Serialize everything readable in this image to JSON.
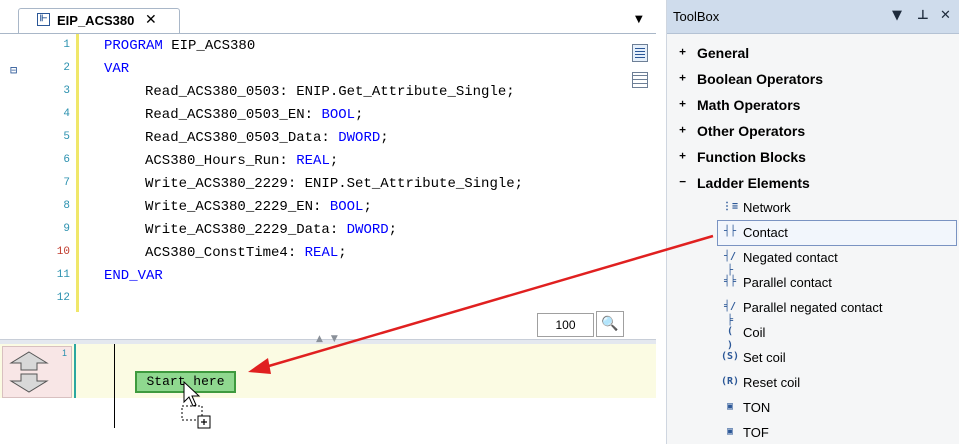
{
  "editor_tab": {
    "title": "EIP_ACS380",
    "close": "✕",
    "menu": "▼"
  },
  "code_lines": [
    {
      "num": "1",
      "text": "PROGRAM EIP_ACS380"
    },
    {
      "num": "2",
      "text": "VAR"
    },
    {
      "num": "3",
      "text": "Read_ACS380_0503: ENIP.Get_Attribute_Single;"
    },
    {
      "num": "4",
      "text": "Read_ACS380_0503_EN: BOOL;"
    },
    {
      "num": "5",
      "text": "Read_ACS380_0503_Data: DWORD;"
    },
    {
      "num": "6",
      "text": "ACS380_Hours_Run: REAL;"
    },
    {
      "num": "7",
      "text": "Write_ACS380_2229: ENIP.Set_Attribute_Single;"
    },
    {
      "num": "8",
      "text": "Write_ACS380_2229_EN: BOOL;"
    },
    {
      "num": "9",
      "text": "Write_ACS380_2229_Data: DWORD;"
    },
    {
      "num": "10",
      "text": "ACS380_ConstTime4: REAL;"
    },
    {
      "num": "11",
      "text": "END_VAR"
    },
    {
      "num": "12",
      "text": ""
    }
  ],
  "zoom": {
    "value": "100"
  },
  "ladder": {
    "network_number": "1",
    "start_here": "Start here"
  },
  "toolbox": {
    "title": "ToolBox",
    "controls": {
      "menu": "▼",
      "pin": "ᵖ",
      "close": "✕"
    },
    "categories": [
      {
        "label": "General",
        "expander": "+"
      },
      {
        "label": "Boolean Operators",
        "expander": "+"
      },
      {
        "label": "Math Operators",
        "expander": "+"
      },
      {
        "label": "Other Operators",
        "expander": "+"
      },
      {
        "label": "Function Blocks",
        "expander": "+"
      },
      {
        "label": "Ladder Elements",
        "expander": "−"
      }
    ],
    "ladder_items": [
      {
        "label": "Network",
        "icon": "network-icon",
        "glyph": "⋮≡"
      },
      {
        "label": "Contact",
        "icon": "contact-icon",
        "glyph": "┤├"
      },
      {
        "label": "Negated contact",
        "icon": "negated-contact-icon",
        "glyph": "┤/├"
      },
      {
        "label": "Parallel contact",
        "icon": "parallel-contact-icon",
        "glyph": "╡╞"
      },
      {
        "label": "Parallel negated contact",
        "icon": "parallel-negated-contact-icon",
        "glyph": "╡/╞"
      },
      {
        "label": "Coil",
        "icon": "coil-icon",
        "glyph": "( )"
      },
      {
        "label": "Set coil",
        "icon": "set-coil-icon",
        "glyph": "(S)"
      },
      {
        "label": "Reset coil",
        "icon": "reset-coil-icon",
        "glyph": "(R)"
      },
      {
        "label": "TON",
        "icon": "ton-icon",
        "glyph": "▣"
      },
      {
        "label": "TOF",
        "icon": "tof-icon",
        "glyph": "▣"
      }
    ],
    "selected_item": "Contact"
  },
  "colors": {
    "keyword": "#0000ff",
    "line_number": "#2b91af",
    "start_here_bg": "#8fd88f",
    "drag_arrow": "#e02020"
  }
}
